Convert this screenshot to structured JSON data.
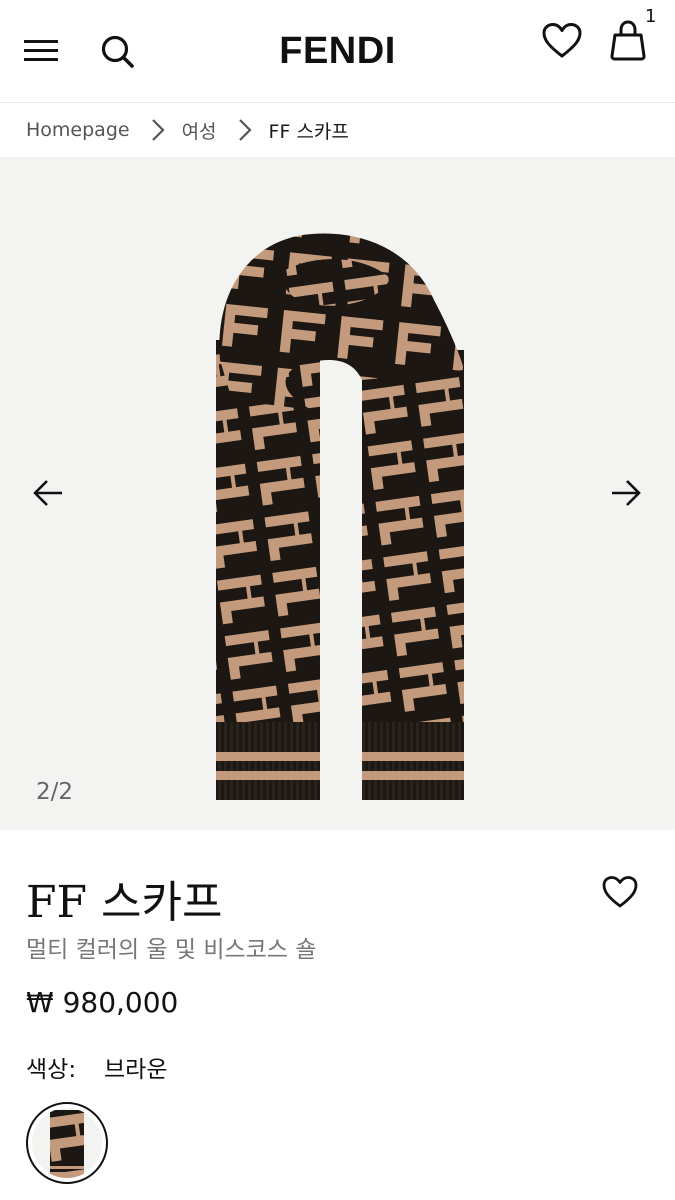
{
  "header": {
    "brand": "FENDI",
    "cart_count": "1",
    "icons": [
      "menu-icon",
      "search-icon",
      "heart-icon",
      "bag-icon"
    ]
  },
  "breadcrumb": [
    {
      "label": "Homepage"
    },
    {
      "label": "여성"
    },
    {
      "label": "FF 스카프"
    }
  ],
  "gallery": {
    "counter": "2/2",
    "background": "#f3f3f2",
    "pattern_colors": {
      "dark": "#1c1712",
      "light": "#c49a7c"
    }
  },
  "product": {
    "title": "FF 스카프",
    "subtitle": "멀티 컬러의 울 및 비스코스 숄",
    "price": "₩ 980,000",
    "color_label": "색상:",
    "color_value": "브라운"
  }
}
